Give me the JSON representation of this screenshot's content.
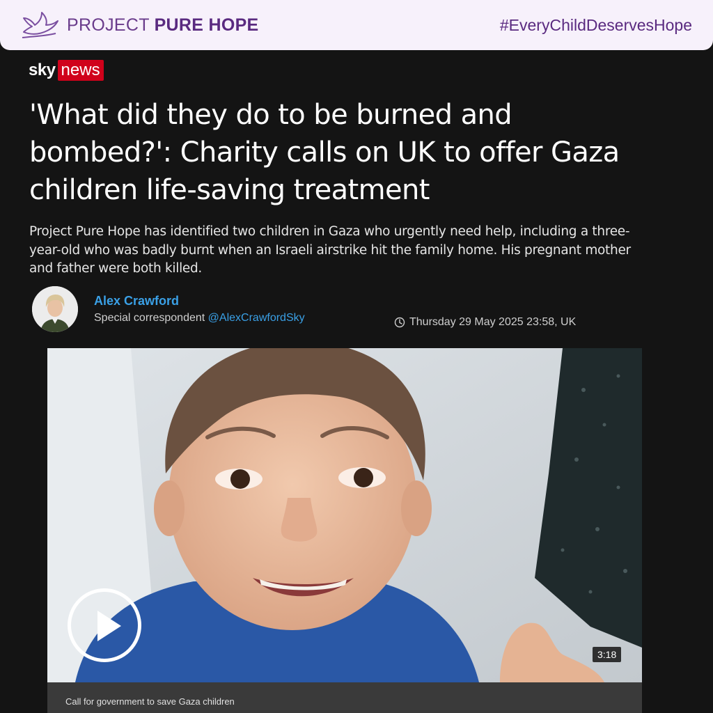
{
  "banner": {
    "brand_light": "PROJECT ",
    "brand_bold": "PURE HOPE",
    "hashtag": "#EveryChildDeservesHope",
    "logo_icon": "dove-icon",
    "brand_color": "#5a2a80"
  },
  "source": {
    "sky": "sky",
    "news": "news",
    "news_color": "#d0021b"
  },
  "article": {
    "headline": "'What did they do to be burned and bombed?': Charity calls on UK to offer Gaza children life-saving treatment",
    "standfirst": "Project Pure Hope has identified two children in Gaza who urgently need help, including a three-year-old who was badly burnt when an Israeli airstrike hit the family home. His pregnant mother and father were both killed."
  },
  "author": {
    "name": "Alex Crawford",
    "role": "Special correspondent",
    "handle": "@AlexCrawfordSky",
    "link_color": "#3aa0e6"
  },
  "meta": {
    "timestamp": "Thursday 29 May 2025 23:58, UK",
    "clock_icon": "clock-icon"
  },
  "video": {
    "duration": "3:18",
    "caption": "Call for government to save Gaza children",
    "play_icon": "play-icon"
  }
}
